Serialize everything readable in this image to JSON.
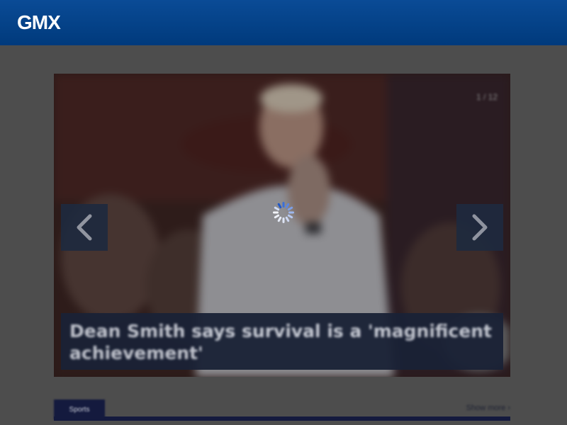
{
  "header": {
    "logo_text": "GMX"
  },
  "carousel": {
    "pager": "1 / 12",
    "headline": "Dean Smith says survival is a 'magnificent achievement'",
    "prev_icon": "chevron-left-icon",
    "next_icon": "chevron-right-icon",
    "loading_icon": "loading-spinner-icon"
  },
  "section": {
    "tab_label": "Sports",
    "show_more": "Show more ›"
  },
  "colors": {
    "header": "#003a7c",
    "overlay": "#4a4a4a",
    "caption_bg": "#1a2236",
    "section_tab": "#141a3e"
  }
}
